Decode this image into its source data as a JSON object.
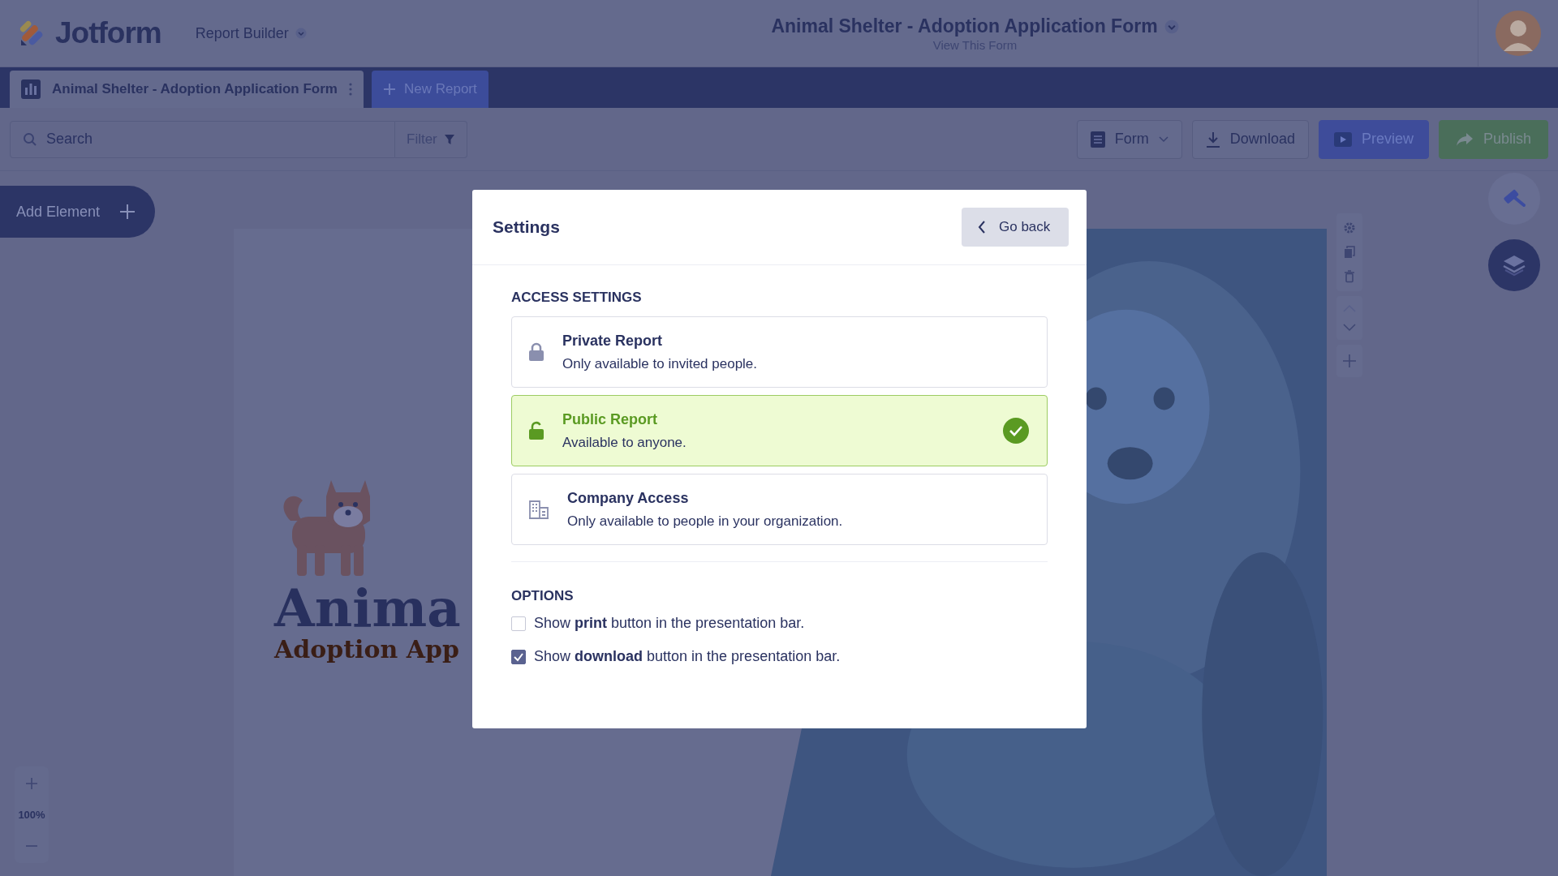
{
  "header": {
    "logo": "Jotform",
    "product": "Report Builder",
    "form_title": "Animal Shelter - Adoption Application Form",
    "form_link": "View This Form"
  },
  "tabs": [
    {
      "label": "Animal Shelter - Adoption Application Form",
      "selected": true
    },
    {
      "label": "New Report",
      "selected": false
    }
  ],
  "toolbar": {
    "search": {
      "placeholder": "Search"
    },
    "filter": "Filter",
    "buttons": [
      {
        "label": "Form",
        "kind": "form"
      },
      {
        "label": "Download",
        "kind": "download"
      },
      {
        "label": "Preview",
        "kind": "preview"
      },
      {
        "label": "Publish",
        "kind": "publish"
      }
    ]
  },
  "add_element": "Add Element",
  "zoom": "100%",
  "canvas": {
    "title": "Anima",
    "subtitle": "Adoption App"
  },
  "dialog": {
    "title": "Settings",
    "back": "Go back",
    "access_heading": "ACCESS SETTINGS",
    "access_options": [
      {
        "title": "Private Report",
        "description": "Only available to invited people.",
        "kind": "lock",
        "selected": false
      },
      {
        "title": "Public Report",
        "description": "Available to anyone.",
        "kind": "unlock",
        "selected": true
      },
      {
        "title": "Company Access",
        "description": "Only available to people in your organization.",
        "kind": "building",
        "selected": false
      }
    ],
    "options_heading": "OPTIONS",
    "options": [
      {
        "label": "Show **print** button in the presentation bar.",
        "checked": false
      },
      {
        "label": "Show **download** button in the presentation bar.",
        "checked": true
      }
    ]
  }
}
